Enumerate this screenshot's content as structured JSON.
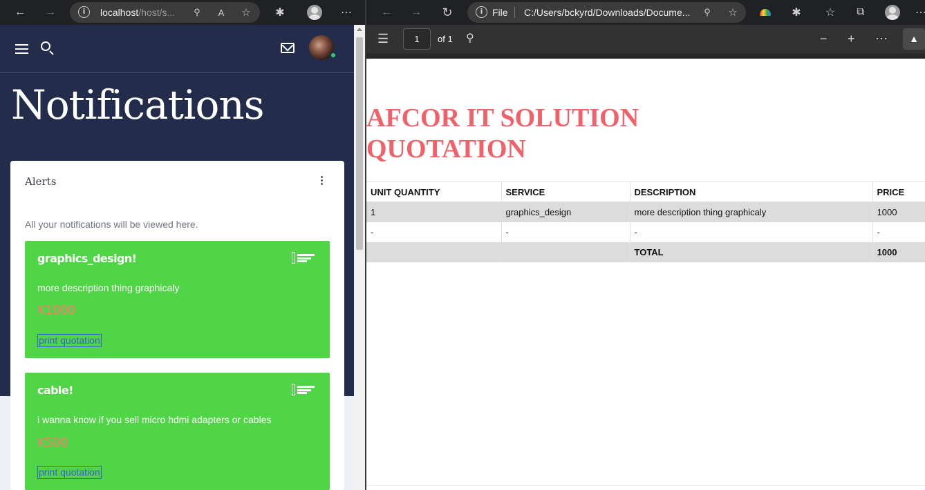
{
  "left_browser": {
    "url_host": "localhost",
    "url_path": "/host/s...",
    "icons": [
      "back-arrow-icon",
      "forward-arrow-icon",
      "info-icon",
      "key-icon",
      "read-aloud-icon",
      "add-favorite-icon",
      "extensions-icon",
      "profile-icon",
      "more-icon"
    ]
  },
  "app": {
    "page_title": "Notifications",
    "card_title": "Alerts",
    "card_description": "All your notifications will be viewed here.",
    "alerts": [
      {
        "title": "graphics_design!",
        "description": "more description thing graphicaly",
        "price": "K1000",
        "button": "print quotation"
      },
      {
        "title": "cable!",
        "description": "i wanna know if you sell micro hdmi adapters or cables",
        "price": "K500",
        "button": "print quotation"
      }
    ],
    "colors": {
      "header_bg": "#232c4a",
      "alert_bg": "#50d546",
      "price": "#ff7b72",
      "button": "#3b5ecf"
    }
  },
  "right_browser": {
    "url_scheme_label": "File",
    "url": "C:/Users/bckyrd/Downloads/Docume...",
    "icons": [
      "back-arrow-icon",
      "forward-arrow-icon",
      "refresh-icon",
      "info-icon",
      "zoom-icon",
      "add-favorite-icon",
      "extension-icon",
      "extensions-icon",
      "favorites-icon",
      "collections-icon",
      "profile-icon",
      "more-icon"
    ]
  },
  "pdf_viewer": {
    "page_number": "1",
    "page_count": "of 1",
    "icons": [
      "contents-icon",
      "search-icon",
      "zoom-out-icon",
      "zoom-in-icon",
      "more-icon",
      "pin-icon"
    ]
  },
  "quotation": {
    "heading_line1": "AFCOR IT SOLUTION",
    "heading_line2": "QUOTATION",
    "headers": [
      "UNIT QUANTITY",
      "SERVICE",
      "DESCRIPTION",
      "PRICE"
    ],
    "rows": [
      [
        "1",
        "graphics_design",
        "more description thing graphicaly",
        "1000"
      ],
      [
        "-",
        "-",
        "-",
        "-"
      ]
    ],
    "total_label": "TOTAL",
    "total_value": "1000",
    "heading_color": "#f0626a"
  }
}
